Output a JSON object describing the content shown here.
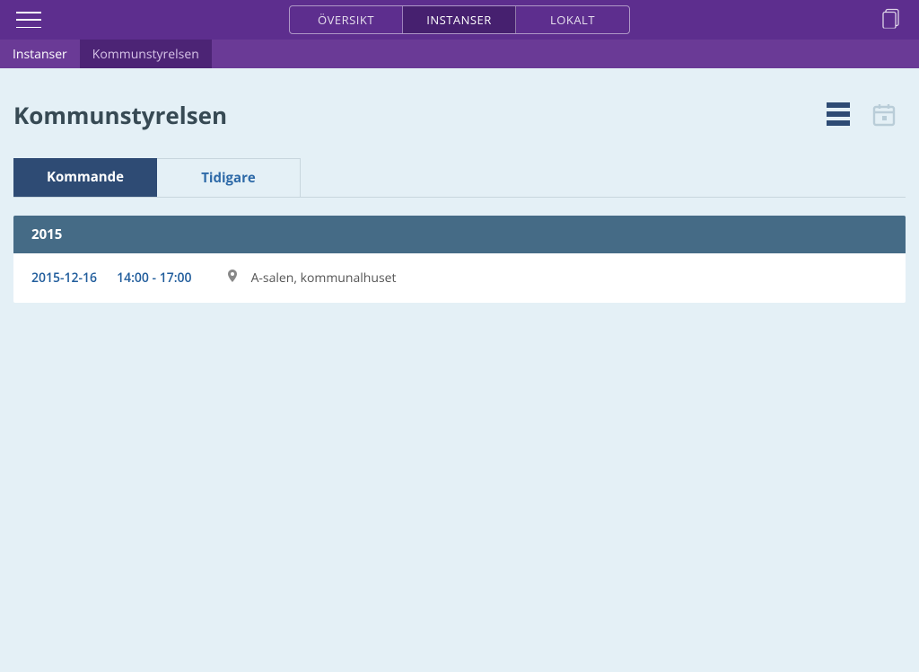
{
  "topnav": {
    "segments": [
      {
        "label": "ÖVERSIKT",
        "active": false
      },
      {
        "label": "INSTANSER",
        "active": true
      },
      {
        "label": "LOKALT",
        "active": false
      }
    ]
  },
  "breadcrumb": {
    "root": "Instanser",
    "current": "Kommunstyrelsen"
  },
  "page": {
    "title": "Kommunstyrelsen"
  },
  "tabs": {
    "upcoming": "Kommande",
    "past": "Tidigare"
  },
  "year_header": "2015",
  "events": [
    {
      "date": "2015-12-16",
      "time": "14:00 - 17:00",
      "location": "A-salen, kommunalhuset"
    }
  ],
  "icons": {
    "hamburger": "menu-icon",
    "clipboard": "clipboard-icon",
    "list": "list-view-icon",
    "calendar": "calendar-view-icon",
    "pin": "location-pin-icon"
  }
}
